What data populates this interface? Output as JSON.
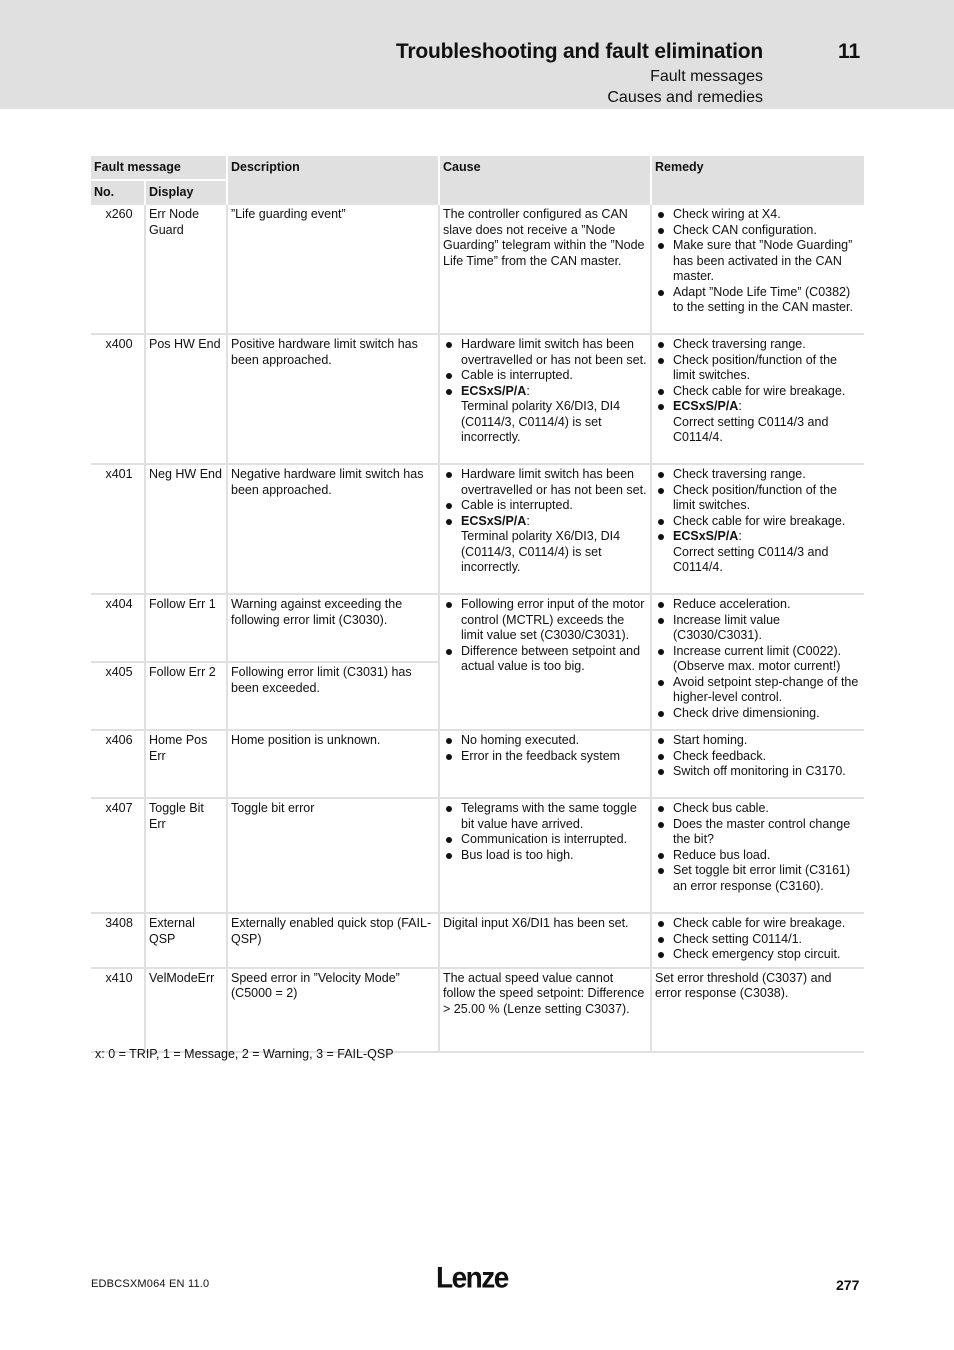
{
  "header": {
    "title": "Troubleshooting and fault elimination",
    "chapter": "11",
    "subtitle1": "Fault messages",
    "subtitle2": "Causes and remedies"
  },
  "table": {
    "headers": {
      "fault_message": "Fault message",
      "no": "No.",
      "display": "Display",
      "description": "Description",
      "cause": "Cause",
      "remedy": "Remedy"
    },
    "rows": [
      {
        "no": "x260",
        "display": "Err Node Guard",
        "description": "”Life guarding event”",
        "cause_text": "The controller configured as CAN slave does not receive a ”Node Guarding” telegram within the ”Node Life Time” from the CAN master.",
        "remedy": [
          "Check wiring at X4.",
          "Check CAN configuration.",
          "Make sure that ”Node Guarding” has been activated in the CAN master.",
          "Adapt ”Node Life Time” (C0382) to the setting in the CAN master."
        ]
      },
      {
        "no": "x400",
        "display": "Pos HW End",
        "description": "Positive hardware limit switch has been approached.",
        "cause": [
          "Hardware limit switch has been overtravelled or has not been set.",
          "Cable is interrupted."
        ],
        "cause_bold": "ECSxS/P/A",
        "cause_bold_text": "Terminal polarity X6/DI3, DI4 (C0114/3, C0114/4) is set incorrectly.",
        "remedy": [
          "Check traversing range.",
          "Check position/function of the limit switches.",
          "Check cable for wire breakage."
        ],
        "remedy_bold": "ECSxS/P/A",
        "remedy_bold_text": "Correct setting C0114/3 and C0114/4."
      },
      {
        "no": "x401",
        "display": "Neg HW End",
        "description": "Negative hardware limit switch has been approached.",
        "cause": [
          "Hardware limit switch has been overtravelled or has not been set.",
          "Cable is interrupted."
        ],
        "cause_bold": "ECSxS/P/A",
        "cause_bold_text": "Terminal polarity X6/DI3, DI4 (C0114/3, C0114/4) is set incorrectly.",
        "remedy": [
          "Check traversing range.",
          "Check position/function of the limit switches.",
          "Check cable for wire breakage."
        ],
        "remedy_bold": "ECSxS/P/A",
        "remedy_bold_text": "Correct setting C0114/3 and C0114/4."
      },
      {
        "no": "x404",
        "display": "Follow Err 1",
        "description": "Warning against exceeding the following error limit  (C3030).",
        "cause": [
          "Following error input of the motor control (MCTRL) exceeds the limit value set (C3030/C3031).",
          "Difference between setpoint and actual value is too big."
        ],
        "remedy": [
          "Reduce acceleration.",
          "Increase limit value (C3030/C3031).",
          "Increase current limit (C0022). (Observe max. motor current!)",
          "Avoid setpoint step-change of the higher-level control.",
          "Check drive dimensioning."
        ]
      },
      {
        "no": "x405",
        "display": "Follow Err 2",
        "description": "Following error limit (C3031) has been exceeded."
      },
      {
        "no": "x406",
        "display": "Home Pos Err",
        "description": "Home position is unknown.",
        "cause": [
          "No homing executed.",
          "Error in the feedback system"
        ],
        "remedy": [
          "Start homing.",
          "Check feedback.",
          "Switch off monitoring in C3170."
        ]
      },
      {
        "no": "x407",
        "display": "Toggle Bit Err",
        "description": "Toggle bit error",
        "cause": [
          "Telegrams with the same toggle bit value have arrived.",
          "Communication is interrupted.",
          "Bus load is too high."
        ],
        "remedy": [
          "Check bus cable.",
          "Does the master control change the bit?",
          "Reduce bus load.",
          "Set toggle bit error limit (C3161) an error response (C3160)."
        ]
      },
      {
        "no": "3408",
        "display": "External QSP",
        "description": "Externally enabled quick stop (FAIL-QSP)",
        "cause_text": "Digital input X6/DI1 has been set.",
        "remedy": [
          "Check cable for wire breakage.",
          "Check setting C0114/1.",
          "Check emergency stop circuit."
        ]
      },
      {
        "no": "x410",
        "display": "VelModeErr",
        "description": "Speed error in ”Velocity Mode” (C5000 = 2)",
        "cause_text": "The actual speed value cannot follow the speed setpoint: Difference > 25.00 % (Lenze setting C3037).",
        "remedy_text": "Set error threshold (C3037) and error response (C3038)."
      }
    ]
  },
  "footnote": "x: 0 = TRIP, 1 = Message, 2 = Warning, 3 = FAIL-QSP",
  "footer": {
    "doc_id": "EDBCSXM064  EN  11.0",
    "logo": "Lenze",
    "page": "277"
  }
}
